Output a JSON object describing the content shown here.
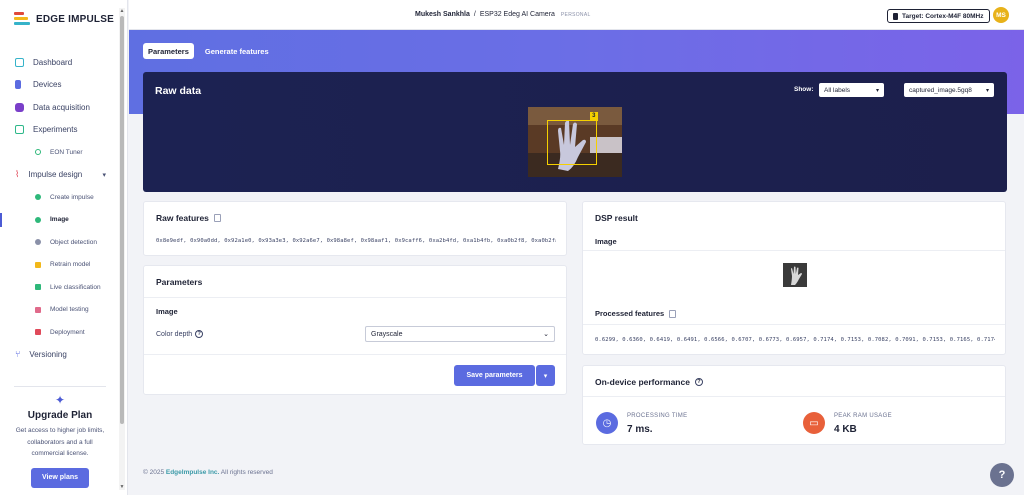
{
  "brand": {
    "name": "EDGE IMPULSE"
  },
  "sidebar": {
    "items": [
      {
        "label": "Dashboard",
        "icon": "monitor-icon",
        "color": "#36b3c9"
      },
      {
        "label": "Devices",
        "icon": "devices-icon",
        "color": "#5b6be0"
      },
      {
        "label": "Data acquisition",
        "icon": "database-icon",
        "color": "#7a3fc9"
      },
      {
        "label": "Experiments",
        "icon": "grid-icon",
        "color": "#2eb88a"
      }
    ],
    "eon_tuner": "EON Tuner",
    "impulse_design": "Impulse design",
    "impulse_subitems": [
      {
        "label": "Create impulse",
        "color": "#2eb87a"
      },
      {
        "label": "Image",
        "color": "#2eb87a"
      },
      {
        "label": "Object detection",
        "color": "#8a90a8"
      },
      {
        "label": "Retrain model",
        "color": "#f2b81a"
      },
      {
        "label": "Live classification",
        "color": "#2eb87a"
      },
      {
        "label": "Model testing",
        "color": "#e06a8a"
      },
      {
        "label": "Deployment",
        "color": "#e04a5a"
      }
    ],
    "versioning": "Versioning",
    "upgrade": {
      "title": "Upgrade Plan",
      "text": "Get access to higher job limits, collaborators and a full commercial license.",
      "button": "View plans"
    }
  },
  "topbar": {
    "user": "Mukesh Sankhla",
    "separator": "/",
    "project": "ESP32 Edeg AI Camera",
    "badge": "PERSONAL",
    "target": "Target: Cortex-M4F 80MHz",
    "avatar_initials": "MS"
  },
  "tabs": [
    {
      "label": "Parameters",
      "active": true
    },
    {
      "label": "Generate features",
      "active": false
    }
  ],
  "raw_data": {
    "title": "Raw data",
    "show_label": "Show:",
    "labels_select": "All labels",
    "sample_select": "captured_image.5gq8",
    "bbox_label": "3"
  },
  "raw_features": {
    "title": "Raw features",
    "values": "0x8e9edf, 0x90a0dd, 0x92a1e0, 0x93a3e3, 0x92a6e7, 0x98a8ef, 0x98aaf1, 0x9caff6, 0xa2b4fd, 0xa1b4fb, 0xa0b2f8, 0xa0b2fa, …"
  },
  "parameters": {
    "title": "Parameters",
    "section": "Image",
    "color_depth_label": "Color depth",
    "color_depth_value": "Grayscale",
    "save_button": "Save parameters"
  },
  "dsp": {
    "title": "DSP result",
    "image_label": "Image",
    "processed_title": "Processed features",
    "processed_values": "0.6299, 0.6360, 0.6419, 0.6491, 0.6566, 0.6707, 0.6773, 0.6957, 0.7174, 0.7153, 0.7082, 0.7091, 0.7153, 0.7165, 0.7174, …"
  },
  "performance": {
    "title": "On-device performance",
    "processing_label": "PROCESSING TIME",
    "processing_value": "7 ms.",
    "ram_label": "PEAK RAM USAGE",
    "ram_value": "4 KB"
  },
  "footer": {
    "copyright": "© 2025",
    "company": "EdgeImpulse Inc.",
    "rights": "All rights reserved"
  }
}
